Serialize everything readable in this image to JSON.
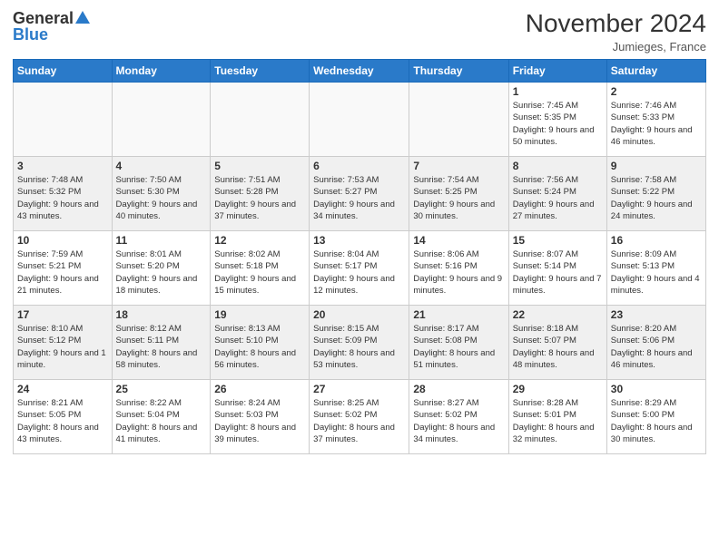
{
  "header": {
    "logo_general": "General",
    "logo_blue": "Blue",
    "month_title": "November 2024",
    "location": "Jumieges, France"
  },
  "weekdays": [
    "Sunday",
    "Monday",
    "Tuesday",
    "Wednesday",
    "Thursday",
    "Friday",
    "Saturday"
  ],
  "weeks": [
    [
      {
        "day": "",
        "info": ""
      },
      {
        "day": "",
        "info": ""
      },
      {
        "day": "",
        "info": ""
      },
      {
        "day": "",
        "info": ""
      },
      {
        "day": "",
        "info": ""
      },
      {
        "day": "1",
        "info": "Sunrise: 7:45 AM\nSunset: 5:35 PM\nDaylight: 9 hours and 50 minutes."
      },
      {
        "day": "2",
        "info": "Sunrise: 7:46 AM\nSunset: 5:33 PM\nDaylight: 9 hours and 46 minutes."
      }
    ],
    [
      {
        "day": "3",
        "info": "Sunrise: 7:48 AM\nSunset: 5:32 PM\nDaylight: 9 hours and 43 minutes."
      },
      {
        "day": "4",
        "info": "Sunrise: 7:50 AM\nSunset: 5:30 PM\nDaylight: 9 hours and 40 minutes."
      },
      {
        "day": "5",
        "info": "Sunrise: 7:51 AM\nSunset: 5:28 PM\nDaylight: 9 hours and 37 minutes."
      },
      {
        "day": "6",
        "info": "Sunrise: 7:53 AM\nSunset: 5:27 PM\nDaylight: 9 hours and 34 minutes."
      },
      {
        "day": "7",
        "info": "Sunrise: 7:54 AM\nSunset: 5:25 PM\nDaylight: 9 hours and 30 minutes."
      },
      {
        "day": "8",
        "info": "Sunrise: 7:56 AM\nSunset: 5:24 PM\nDaylight: 9 hours and 27 minutes."
      },
      {
        "day": "9",
        "info": "Sunrise: 7:58 AM\nSunset: 5:22 PM\nDaylight: 9 hours and 24 minutes."
      }
    ],
    [
      {
        "day": "10",
        "info": "Sunrise: 7:59 AM\nSunset: 5:21 PM\nDaylight: 9 hours and 21 minutes."
      },
      {
        "day": "11",
        "info": "Sunrise: 8:01 AM\nSunset: 5:20 PM\nDaylight: 9 hours and 18 minutes."
      },
      {
        "day": "12",
        "info": "Sunrise: 8:02 AM\nSunset: 5:18 PM\nDaylight: 9 hours and 15 minutes."
      },
      {
        "day": "13",
        "info": "Sunrise: 8:04 AM\nSunset: 5:17 PM\nDaylight: 9 hours and 12 minutes."
      },
      {
        "day": "14",
        "info": "Sunrise: 8:06 AM\nSunset: 5:16 PM\nDaylight: 9 hours and 9 minutes."
      },
      {
        "day": "15",
        "info": "Sunrise: 8:07 AM\nSunset: 5:14 PM\nDaylight: 9 hours and 7 minutes."
      },
      {
        "day": "16",
        "info": "Sunrise: 8:09 AM\nSunset: 5:13 PM\nDaylight: 9 hours and 4 minutes."
      }
    ],
    [
      {
        "day": "17",
        "info": "Sunrise: 8:10 AM\nSunset: 5:12 PM\nDaylight: 9 hours and 1 minute."
      },
      {
        "day": "18",
        "info": "Sunrise: 8:12 AM\nSunset: 5:11 PM\nDaylight: 8 hours and 58 minutes."
      },
      {
        "day": "19",
        "info": "Sunrise: 8:13 AM\nSunset: 5:10 PM\nDaylight: 8 hours and 56 minutes."
      },
      {
        "day": "20",
        "info": "Sunrise: 8:15 AM\nSunset: 5:09 PM\nDaylight: 8 hours and 53 minutes."
      },
      {
        "day": "21",
        "info": "Sunrise: 8:17 AM\nSunset: 5:08 PM\nDaylight: 8 hours and 51 minutes."
      },
      {
        "day": "22",
        "info": "Sunrise: 8:18 AM\nSunset: 5:07 PM\nDaylight: 8 hours and 48 minutes."
      },
      {
        "day": "23",
        "info": "Sunrise: 8:20 AM\nSunset: 5:06 PM\nDaylight: 8 hours and 46 minutes."
      }
    ],
    [
      {
        "day": "24",
        "info": "Sunrise: 8:21 AM\nSunset: 5:05 PM\nDaylight: 8 hours and 43 minutes."
      },
      {
        "day": "25",
        "info": "Sunrise: 8:22 AM\nSunset: 5:04 PM\nDaylight: 8 hours and 41 minutes."
      },
      {
        "day": "26",
        "info": "Sunrise: 8:24 AM\nSunset: 5:03 PM\nDaylight: 8 hours and 39 minutes."
      },
      {
        "day": "27",
        "info": "Sunrise: 8:25 AM\nSunset: 5:02 PM\nDaylight: 8 hours and 37 minutes."
      },
      {
        "day": "28",
        "info": "Sunrise: 8:27 AM\nSunset: 5:02 PM\nDaylight: 8 hours and 34 minutes."
      },
      {
        "day": "29",
        "info": "Sunrise: 8:28 AM\nSunset: 5:01 PM\nDaylight: 8 hours and 32 minutes."
      },
      {
        "day": "30",
        "info": "Sunrise: 8:29 AM\nSunset: 5:00 PM\nDaylight: 8 hours and 30 minutes."
      }
    ]
  ]
}
